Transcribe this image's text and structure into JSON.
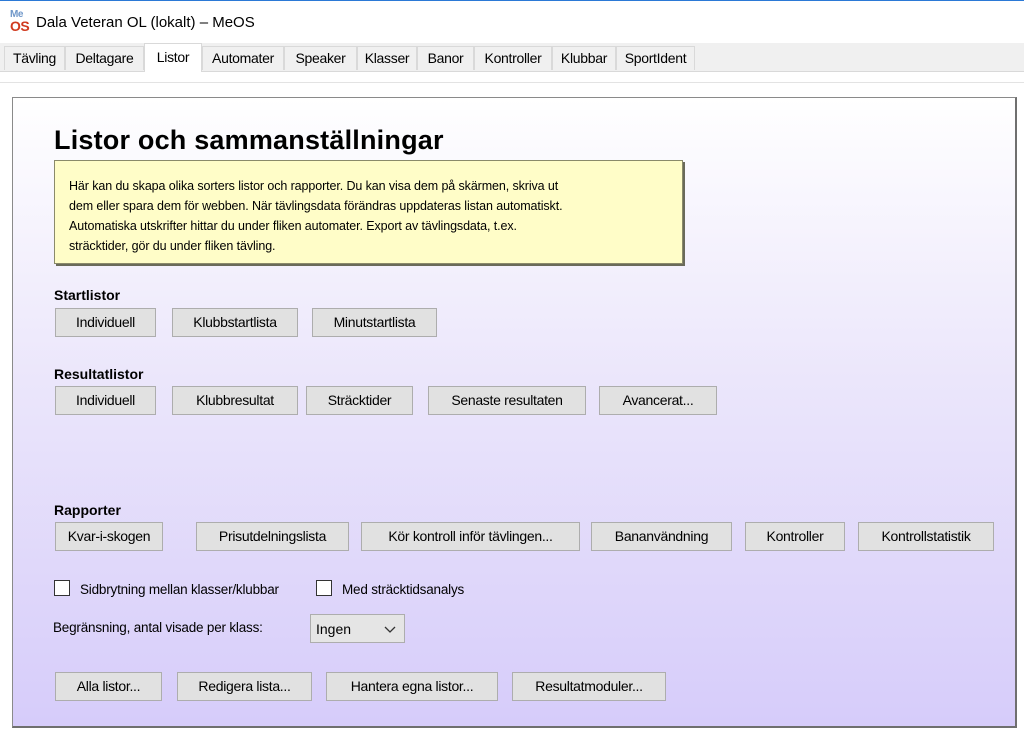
{
  "window": {
    "title": "Dala Veteran OL (lokalt) – MeOS",
    "icon_top": "Me",
    "icon_bottom": "OS",
    "icon_name": "meos-app-icon"
  },
  "tabs": [
    {
      "label": "Tävling",
      "active": false
    },
    {
      "label": "Deltagare",
      "active": false
    },
    {
      "label": "Listor",
      "active": true
    },
    {
      "label": "Automater",
      "active": false
    },
    {
      "label": "Speaker",
      "active": false
    },
    {
      "label": "Klasser",
      "active": false
    },
    {
      "label": "Banor",
      "active": false
    },
    {
      "label": "Kontroller",
      "active": false
    },
    {
      "label": "Klubbar",
      "active": false
    },
    {
      "label": "SportIdent",
      "active": false
    }
  ],
  "main": {
    "heading": "Listor och sammanställningar",
    "info_lines": [
      "Här kan du skapa olika sorters listor och rapporter. Du kan visa dem på skärmen, skriva ut",
      "dem eller spara dem för webben. När tävlingsdata förändras uppdateras listan automatiskt.",
      "Automatiska utskrifter hittar du under fliken automater. Export av tävlingsdata, t.ex.",
      "sträcktider, gör du under fliken tävling."
    ],
    "startlistor": {
      "label": "Startlistor",
      "buttons": [
        "Individuell",
        "Klubbstartlista",
        "Minutstartlista"
      ]
    },
    "resultatlistor": {
      "label": "Resultatlistor",
      "buttons": [
        "Individuell",
        "Klubbresultat",
        "Sträcktider",
        "Senaste resultaten",
        "Avancerat..."
      ]
    },
    "rapporter": {
      "label": "Rapporter",
      "buttons": [
        "Kvar-i-skogen",
        "Prisutdelningslista",
        "Kör kontroll inför tävlingen...",
        "Bananvändning",
        "Kontroller",
        "Kontrollstatistik"
      ]
    },
    "options": {
      "page_break_label": "Sidbrytning mellan klasser/klubbar",
      "page_break_checked": false,
      "split_analysis_label": "Med sträcktidsanalys",
      "split_analysis_checked": false,
      "limit_label": "Begränsning, antal visade per klass:",
      "limit_value": "Ingen"
    },
    "bottom_buttons": [
      "Alla listor...",
      "Redigera lista...",
      "Hantera egna listor...",
      "Resultatmoduler..."
    ]
  }
}
